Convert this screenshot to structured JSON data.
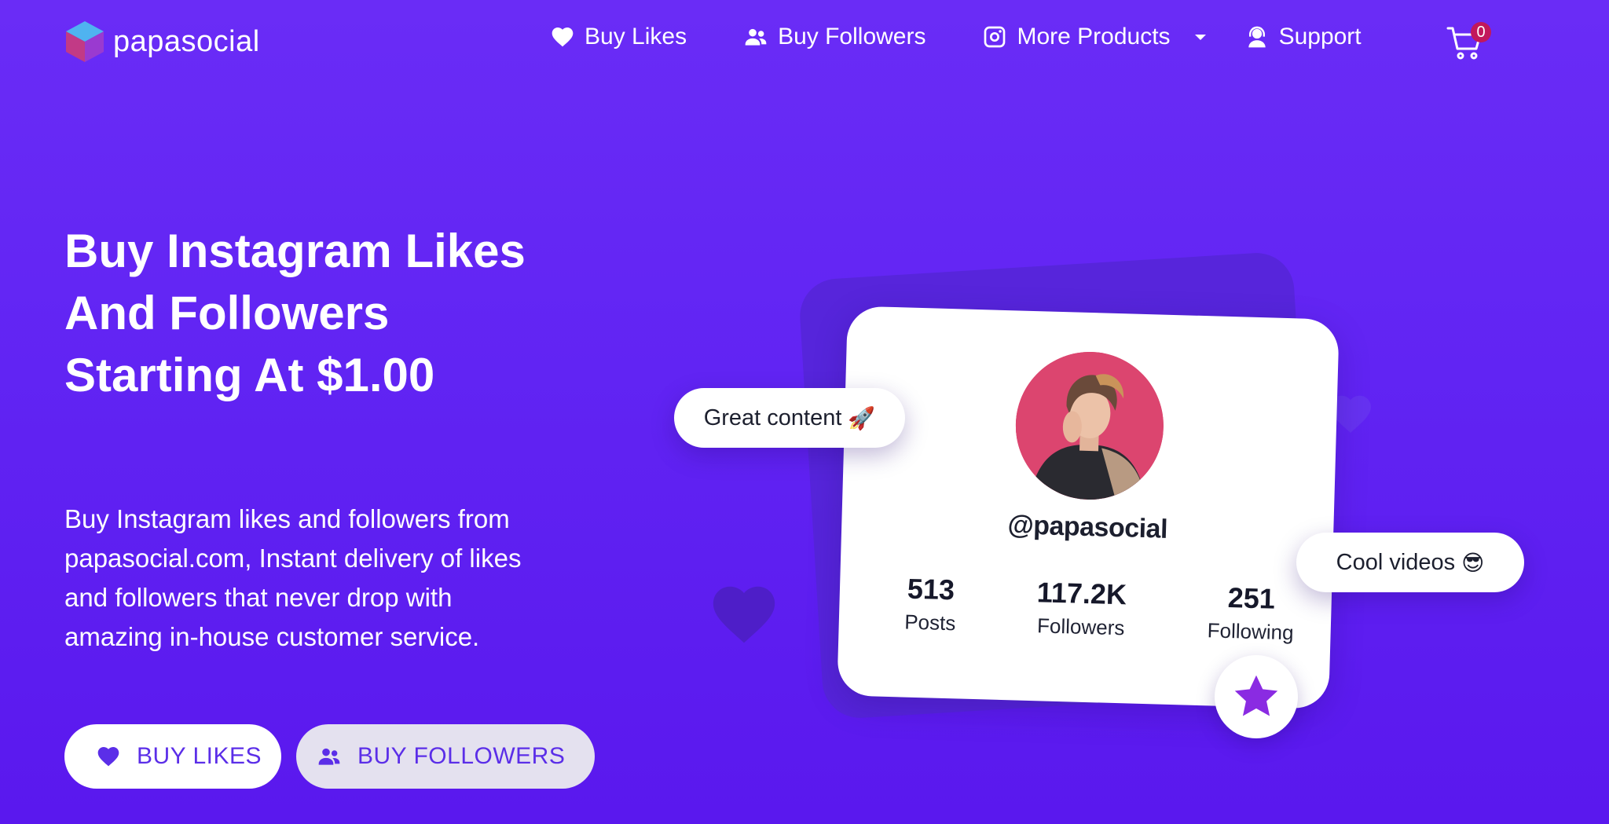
{
  "brand": {
    "name": "papasocial",
    "colors": {
      "background": "#6124f3",
      "accent": "#5b2ee8",
      "badge": "#c2185b",
      "star": "#8a2be2"
    }
  },
  "nav": {
    "items": [
      {
        "label": "Buy Likes",
        "icon": "heart-icon"
      },
      {
        "label": "Buy Followers",
        "icon": "users-icon"
      },
      {
        "label": "More Products",
        "icon": "instagram-icon"
      },
      {
        "label": "Support",
        "icon": "support-agent-icon"
      }
    ],
    "cart": {
      "icon": "cart-icon",
      "count": "0"
    }
  },
  "hero": {
    "title": "Buy Instagram Likes And Followers Starting At $1.00",
    "description": "Buy Instagram likes and followers from papasocial.com, Instant delivery of likes and followers that never drop with amazing in-house customer service.",
    "buttons": {
      "likes": "BUY LIKES",
      "followers": "BUY FOLLOWERS"
    }
  },
  "profile_card": {
    "handle": "@papasocial",
    "stats": [
      {
        "value": "513",
        "label": "Posts"
      },
      {
        "value": "117.2K",
        "label": "Followers"
      },
      {
        "value": "251",
        "label": "Following"
      }
    ]
  },
  "bubbles": {
    "great": {
      "text": "Great content",
      "emoji": "🚀"
    },
    "cool": {
      "text": "Cool videos",
      "emoji": "😎"
    }
  }
}
